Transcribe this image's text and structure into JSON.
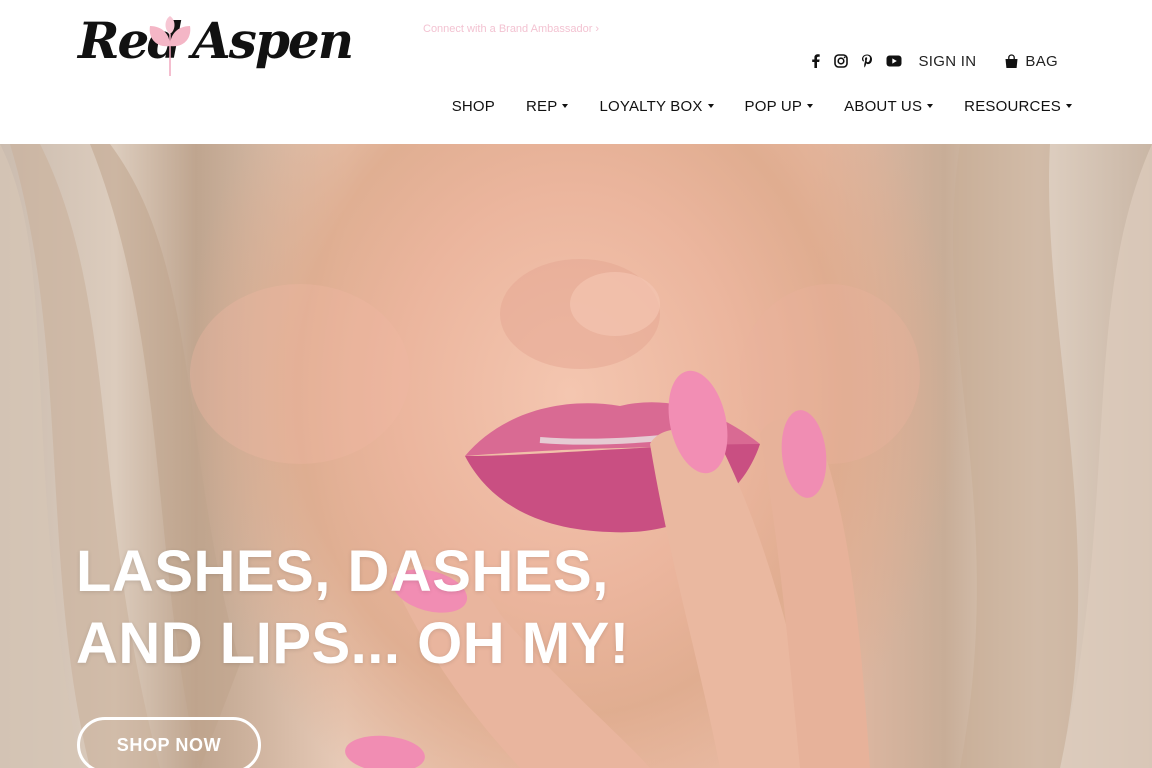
{
  "brand": {
    "logo_text": "Red Aspen",
    "logo_word_1": "Red",
    "logo_word_2": "Aspen",
    "accent_color": "#f1a9bf"
  },
  "header": {
    "ambassador_link": "Connect with a Brand Ambassador ›",
    "social_icons": [
      "facebook-icon",
      "instagram-icon",
      "pinterest-icon",
      "youtube-icon"
    ],
    "sign_in": "SIGN IN",
    "bag": "BAG"
  },
  "nav": {
    "items": [
      {
        "label": "SHOP",
        "dropdown": false
      },
      {
        "label": "REP",
        "dropdown": true
      },
      {
        "label": "LOYALTY BOX",
        "dropdown": true
      },
      {
        "label": "POP UP",
        "dropdown": true
      },
      {
        "label": "ABOUT US",
        "dropdown": true
      },
      {
        "label": "RESOURCES",
        "dropdown": true
      }
    ]
  },
  "hero": {
    "headline_line_1": "LASHES, DASHES,",
    "headline_line_2": "AND LIPS... OH MY!",
    "cta_label": "SHOP NOW"
  }
}
